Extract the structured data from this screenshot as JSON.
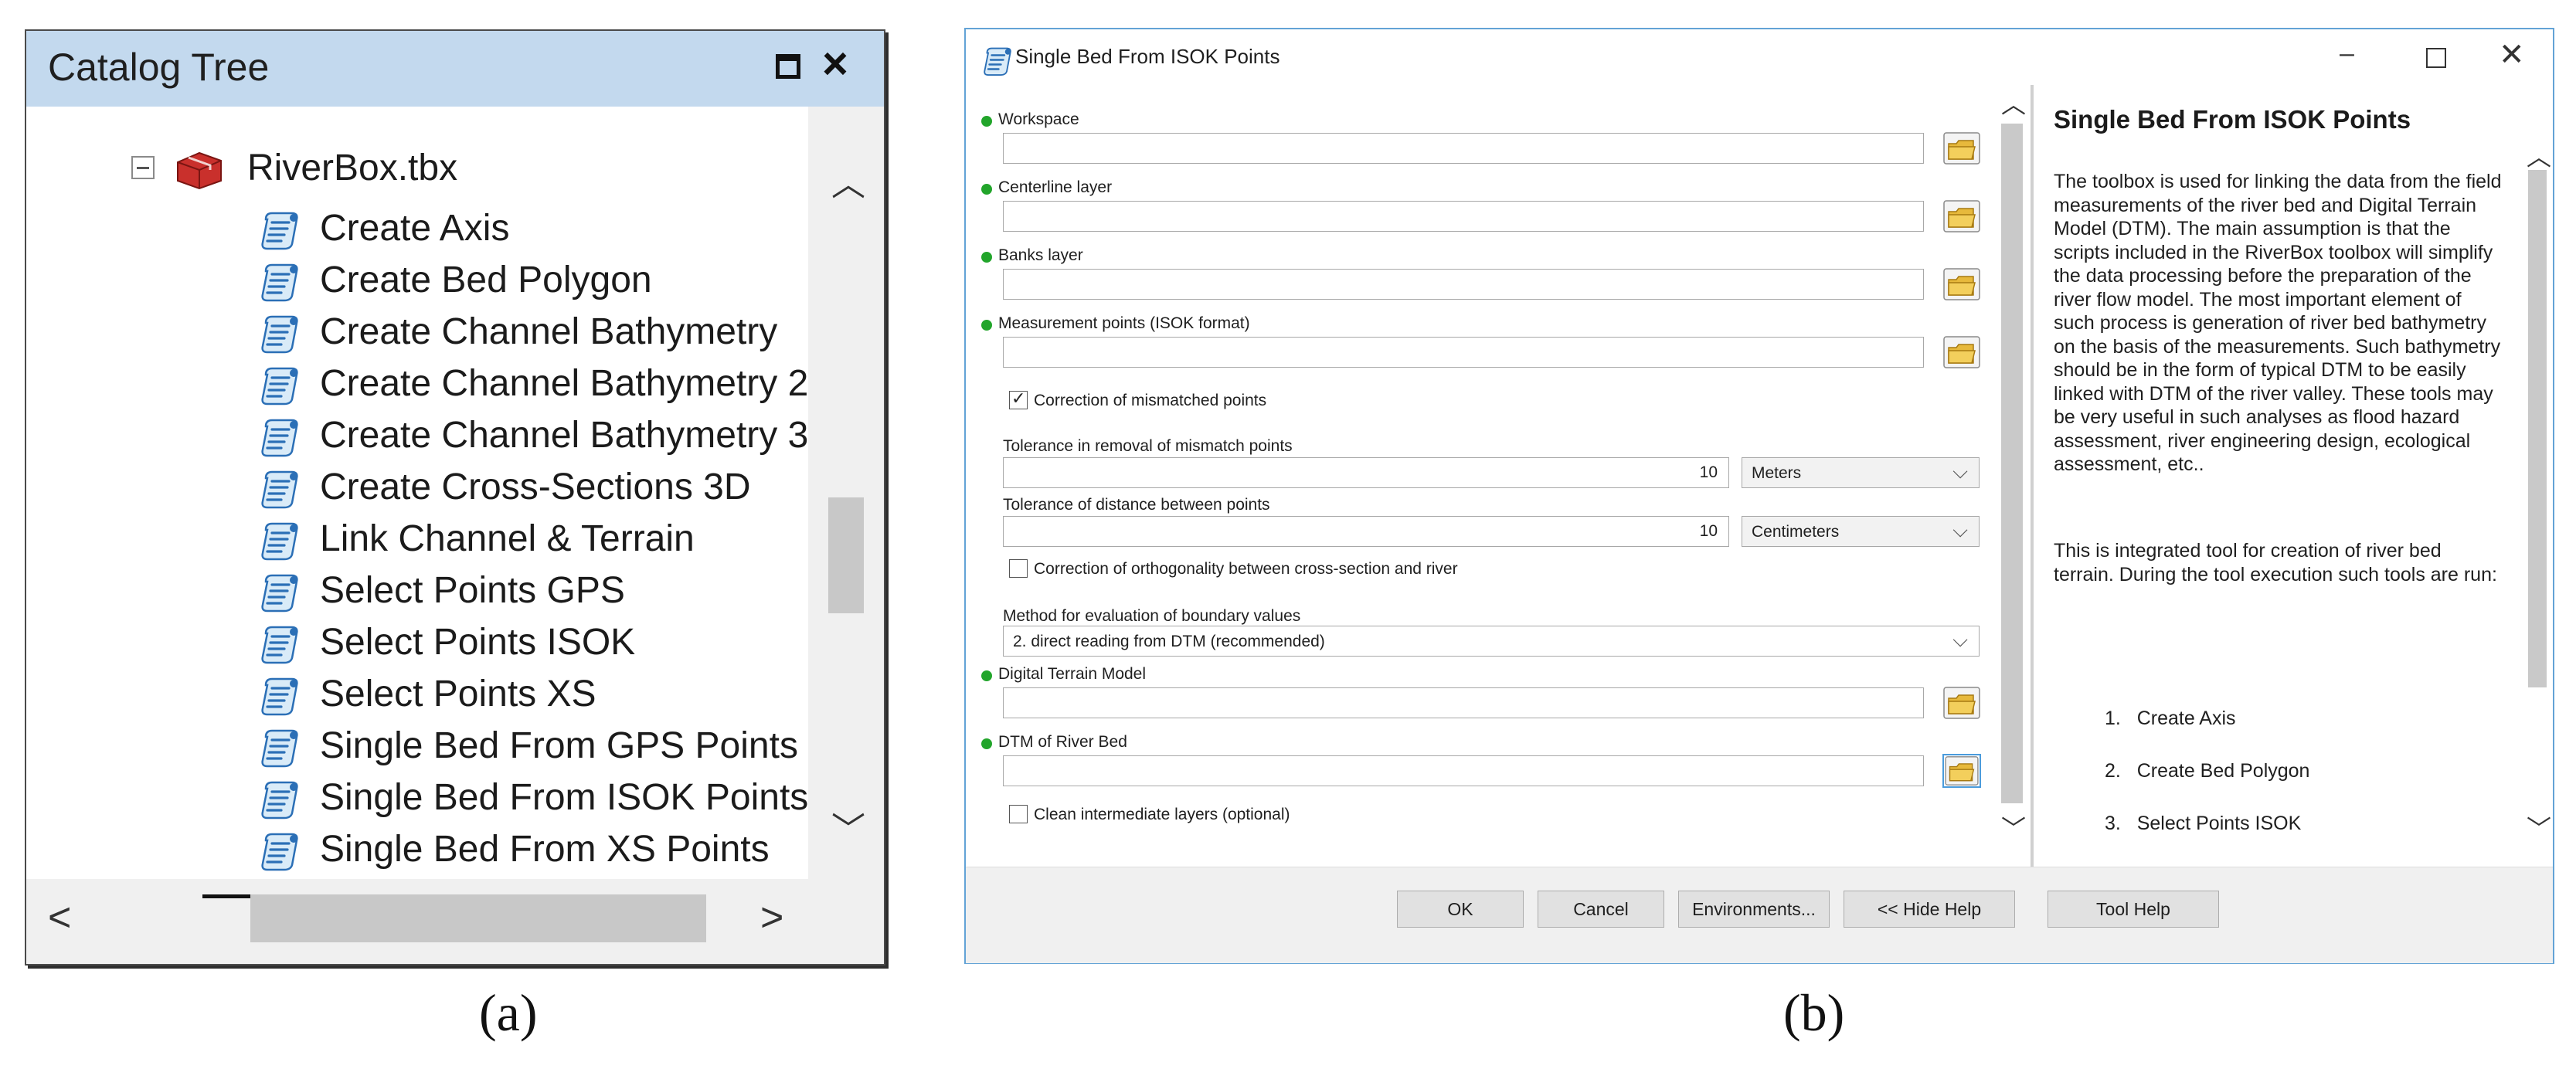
{
  "catalog_tree": {
    "title": "Catalog Tree",
    "root": {
      "label": "RiverBox.tbx",
      "icon": "toolbox-icon",
      "expanded": true
    },
    "items": [
      {
        "label": "Create Axis",
        "icon": "script-icon"
      },
      {
        "label": "Create Bed Polygon",
        "icon": "script-icon"
      },
      {
        "label": "Create Channel Bathymetry",
        "icon": "script-icon"
      },
      {
        "label": "Create Channel Bathymetry 2",
        "icon": "script-icon"
      },
      {
        "label": "Create Channel Bathymetry 3",
        "icon": "script-icon"
      },
      {
        "label": "Create Cross-Sections 3D",
        "icon": "script-icon"
      },
      {
        "label": "Link Channel & Terrain",
        "icon": "script-icon"
      },
      {
        "label": "Select Points GPS",
        "icon": "script-icon"
      },
      {
        "label": "Select Points ISOK",
        "icon": "script-icon"
      },
      {
        "label": "Select Points XS",
        "icon": "script-icon"
      },
      {
        "label": "Single Bed From GPS Points",
        "icon": "script-icon"
      },
      {
        "label": "Single Bed From ISOK Points",
        "icon": "script-icon"
      },
      {
        "label": "Single Bed From XS Points",
        "icon": "script-icon"
      }
    ],
    "controls": {
      "maximize_icon": "maximize-icon",
      "close_icon": "close-icon"
    }
  },
  "dialog": {
    "title": "Single Bed From ISOK Points",
    "controls": {
      "minimize": "–",
      "close": "✕"
    },
    "params": {
      "workspace": {
        "label": "Workspace",
        "value": ""
      },
      "centerline": {
        "label": "Centerline layer",
        "value": ""
      },
      "banks": {
        "label": "Banks layer",
        "value": ""
      },
      "measurement": {
        "label": "Measurement points (ISOK format)",
        "value": ""
      },
      "correction_mismatch": {
        "label": "Correction of mismatched points",
        "checked": true
      },
      "tolerance_removal": {
        "label": "Tolerance in removal of mismatch points",
        "value": "10",
        "unit": "Meters"
      },
      "tolerance_distance": {
        "label": "Tolerance of distance between points",
        "value": "10",
        "unit": "Centimeters"
      },
      "correction_orthogonality": {
        "label": "Correction of orthogonality between cross-section and river",
        "checked": false
      },
      "method": {
        "label": "Method for evaluation of boundary values",
        "value": "2. direct reading from DTM (recommended)"
      },
      "dtm": {
        "label": "Digital Terrain Model",
        "value": ""
      },
      "dtm_river_bed": {
        "label": "DTM of River Bed",
        "value": ""
      },
      "clean_layers": {
        "label": "Clean intermediate layers (optional)",
        "checked": false
      }
    },
    "help": {
      "title": "Single Bed From ISOK Points",
      "paragraph1": "The toolbox is used for linking the data from the field measurements of the river bed and Digital Terrain Model (DTM). The main assumption is that the scripts included in the RiverBox toolbox will simplify the data processing before the preparation of the river flow model. The most important element of such process is generation of river bed bathymetry on the basis of the measurements. Such bathymetry should be in the form of typical DTM to be easily linked with DTM of the river valley. These tools may be very useful in such analyses as flood hazard assessment, river engineering design, ecological assessment, etc..",
      "paragraph2": "This is integrated tool for creation of river bed terrain. During the tool execution such tools are run:",
      "list": [
        {
          "num": "1.",
          "text": "Create Axis"
        },
        {
          "num": "2.",
          "text": "Create Bed Polygon"
        },
        {
          "num": "3.",
          "text": "Select Points ISOK"
        }
      ]
    },
    "buttons": {
      "ok": "OK",
      "cancel": "Cancel",
      "environments": "Environments...",
      "hide_help": "<< Hide Help",
      "tool_help": "Tool Help"
    }
  },
  "captions": {
    "a": "(a)",
    "b": "(b)"
  },
  "colors": {
    "title_bar": "#c3d9ee",
    "required_dot": "#22a52b",
    "dialog_border": "#63a3d6",
    "folder": "#e7b93c"
  }
}
